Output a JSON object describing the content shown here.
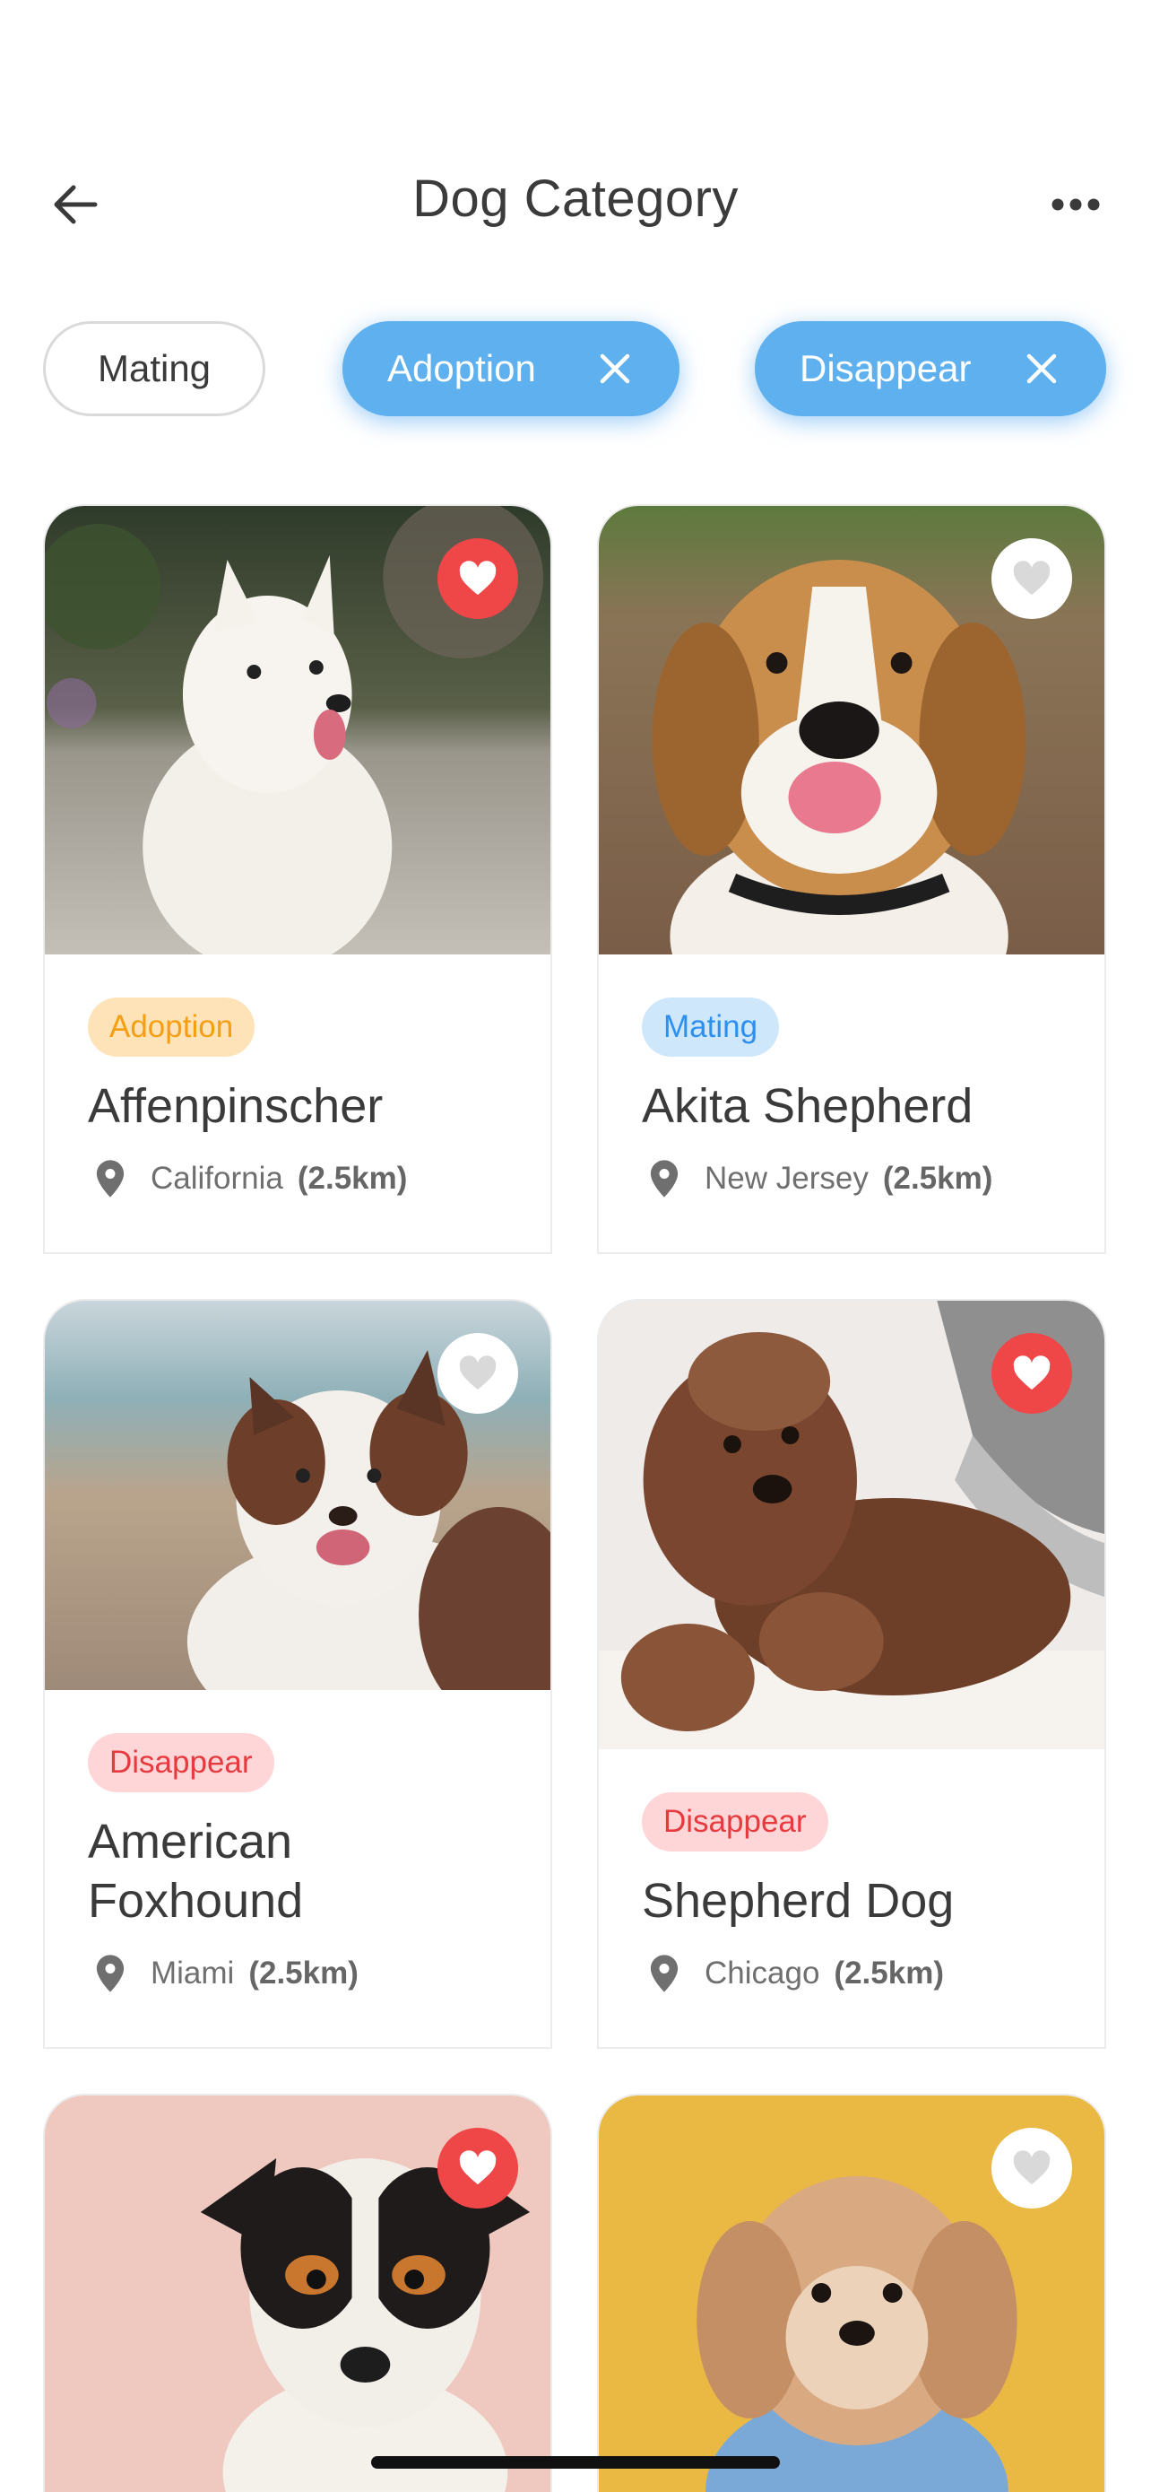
{
  "header": {
    "title": "Dog Category",
    "back_icon": "arrow-left-icon",
    "more_icon": "more-horizontal-icon"
  },
  "filters": [
    {
      "label": "Mating",
      "active": false
    },
    {
      "label": "Adoption",
      "active": true
    },
    {
      "label": "Disappear",
      "active": true
    }
  ],
  "colors": {
    "accent": "#5eb0ef",
    "favorite": "#ef4648",
    "adoption": "#f59e10",
    "mating": "#2d8ff0",
    "disappear": "#e63b3e"
  },
  "cards": [
    {
      "tag": "Adoption",
      "name": "Affenpinscher",
      "location": "California",
      "distance": "(2.5km)",
      "favorite": true,
      "photo": "white-samoyed-dog-photo"
    },
    {
      "tag": "Mating",
      "name": "Akita Shepherd",
      "location": "New Jersey",
      "distance": "(2.5km)",
      "favorite": false,
      "photo": "beagle-dog-photo"
    },
    {
      "tag": "Disappear",
      "name": "American Foxhound",
      "location": "Miami",
      "distance": "(2.5km)",
      "favorite": false,
      "photo": "australian-shepherd-dog-photo"
    },
    {
      "tag": "Disappear",
      "name": "Shepherd Dog",
      "location": "Chicago",
      "distance": "(2.5km)",
      "favorite": true,
      "photo": "brown-doodle-dog-photo"
    },
    {
      "favorite": true,
      "photo": "jack-russell-dog-photo"
    },
    {
      "favorite": false,
      "photo": "maltipoo-dog-photo"
    }
  ]
}
